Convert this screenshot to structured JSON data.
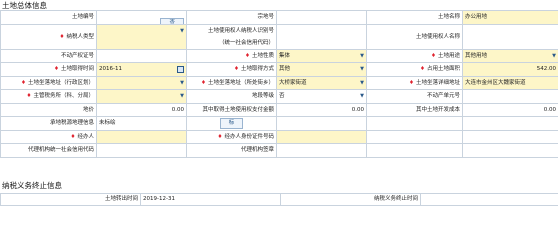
{
  "section1": {
    "title": "土地总体信息"
  },
  "section2": {
    "title": "纳税义务终止信息"
  },
  "row1": {
    "land_no_label": "土地编号",
    "search_btn": "查",
    "parcel_no_label": "宗地号",
    "land_name_label": "土地名称",
    "land_name_value": "办公用地"
  },
  "row2": {
    "taxpayer_type_label": "纳税人类型",
    "user_id_label_line1": "土地使用权人纳税人识别号",
    "user_id_label_line2": "（统一社会信用代码）",
    "user_name_label": "土地使用权人名称"
  },
  "row3": {
    "realestate_cert_label": "不动产权证号",
    "land_nature_label": "土地性质",
    "land_nature_value": "集体",
    "land_use_label": "土地用途",
    "land_use_value": "其他用地"
  },
  "row4": {
    "acquire_time_label": "土地取得时间",
    "acquire_time_value": "2016-11",
    "acquire_method_label": "土地取得方式",
    "acquire_method_value": "其他",
    "area_label": "占用土地面积",
    "area_value": "542.00"
  },
  "row5": {
    "location_district_label": "土地坐落地址（行政区划）",
    "location_street_label": "土地坐落地址（所处街乡）",
    "location_street_value": "大桥家街道",
    "detail_address_label": "土地坐落详细地址",
    "detail_address_value": "大连市金州区大魏家街道"
  },
  "row6": {
    "tax_authority_label": "主管税务所（科、分局）",
    "tax_grade_label": "地段等级",
    "tax_grade_value": "否",
    "realestate_unit_label": "不动产单元号"
  },
  "row7": {
    "price_label": "地价",
    "price_value": "0.00",
    "paid_amount_label": "其中取得土地使用权支付金额",
    "paid_amount_value": "0.00",
    "dev_cost_label": "其中土地开发成本",
    "dev_cost_value": "0.00"
  },
  "row8": {
    "tax_info_label": "承地税源地理信息",
    "tax_info_value": "未标绘",
    "mark_btn": "标"
  },
  "row9": {
    "agent_label": "经办人",
    "agent_id_label": "经办人身份证件号码"
  },
  "row10": {
    "agency_credit_label": "代理机构统一社会信用代码",
    "agency_sign_label": "代理机构签章"
  },
  "row11": {
    "end_time_label": "土地转出时间",
    "end_time_value": "2019-12-31",
    "end_tax_time_label": "纳税义务终止时间"
  }
}
